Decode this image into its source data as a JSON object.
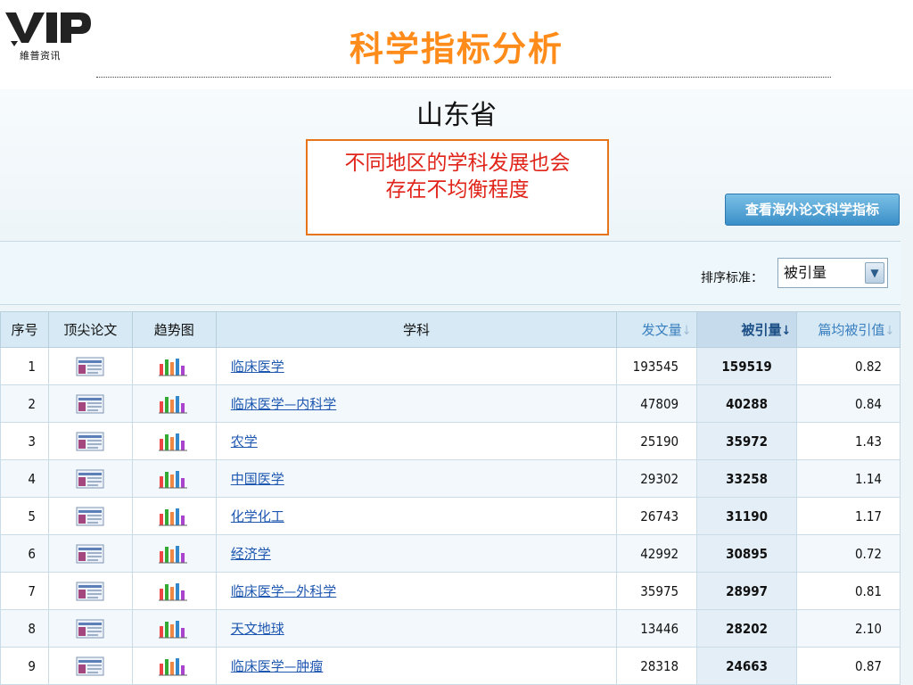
{
  "branding": {
    "logo_sub": "維普资讯"
  },
  "slide": {
    "title": "科学指标分析"
  },
  "page": {
    "province": "山东省",
    "callout": [
      "不同地区的学科发展也会",
      "存在不均衡程度"
    ],
    "overseas_button": "查看海外论文科学指标",
    "sort": {
      "label": "排序标准：",
      "selected": "被引量"
    }
  },
  "table": {
    "headers": {
      "index": "序号",
      "top_papers": "顶尖论文",
      "trend": "趋势图",
      "subject": "学科",
      "publications": "发文量",
      "citations": "被引量",
      "avg_citations": "篇均被引值"
    },
    "rows": [
      {
        "index": "1",
        "subject": "临床医学",
        "publications": "193545",
        "citations": "159519",
        "avg": "0.82"
      },
      {
        "index": "2",
        "subject": "临床医学—内科学",
        "publications": "47809",
        "citations": "40288",
        "avg": "0.84"
      },
      {
        "index": "3",
        "subject": "农学",
        "publications": "25190",
        "citations": "35972",
        "avg": "1.43"
      },
      {
        "index": "4",
        "subject": "中国医学",
        "publications": "29302",
        "citations": "33258",
        "avg": "1.14"
      },
      {
        "index": "5",
        "subject": "化学化工",
        "publications": "26743",
        "citations": "31190",
        "avg": "1.17"
      },
      {
        "index": "6",
        "subject": "经济学",
        "publications": "42992",
        "citations": "30895",
        "avg": "0.72"
      },
      {
        "index": "7",
        "subject": "临床医学—外科学",
        "publications": "35975",
        "citations": "28997",
        "avg": "0.81"
      },
      {
        "index": "8",
        "subject": "天文地球",
        "publications": "13446",
        "citations": "28202",
        "avg": "2.10"
      },
      {
        "index": "9",
        "subject": "临床医学—肿瘤",
        "publications": "28318",
        "citations": "24663",
        "avg": "0.87"
      }
    ]
  },
  "icons": {
    "paper": "document-icon",
    "trend": "bar-chart-icon",
    "sort": "arrow-down-icon",
    "dropdown": "chevron-down-icon"
  },
  "colors": {
    "title": "#ff8c1a",
    "callout_text": "#e0241a",
    "callout_border": "#e8741a",
    "link": "#1e57b0",
    "button": "#3a8fc8"
  }
}
